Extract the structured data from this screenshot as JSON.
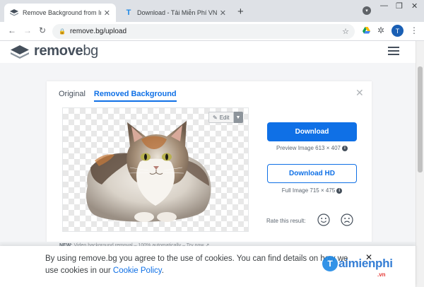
{
  "browser": {
    "tabs": [
      {
        "title": "Remove Background from Image",
        "active": true,
        "icon": "removebg-layers-icon"
      },
      {
        "title": "Download - Tải Miễn Phí VN - Ph",
        "active": false,
        "icon": "t-letter-icon"
      }
    ],
    "new_tab_label": "+",
    "url": "remove.bg/upload",
    "profile_initial": "T"
  },
  "site": {
    "logo_remove": "remove",
    "logo_bg": "bg"
  },
  "result_card": {
    "tab_original": "Original",
    "tab_removed": "Removed Background",
    "edit_label": "Edit",
    "download_label": "Download",
    "preview_info": "Preview Image 613 × 407",
    "download_hd_label": "Download HD",
    "full_info": "Full Image 715 × 475",
    "rate_label": "Rate this result:"
  },
  "news": {
    "prefix": "NEW:",
    "text": "Video background removal – 100% automatically – Try now"
  },
  "cookie": {
    "text_before": "By using remove.bg you agree to the use of cookies. You can find details on how we use cookies in our ",
    "link": "Cookie Policy",
    "text_after": "."
  },
  "watermark": {
    "initial": "T",
    "name": "aimienphi",
    "suffix": ".vn"
  },
  "colors": {
    "accent": "#0f70e6",
    "brand_text": "#454f5b",
    "tab_strip": "#dee1e6"
  }
}
